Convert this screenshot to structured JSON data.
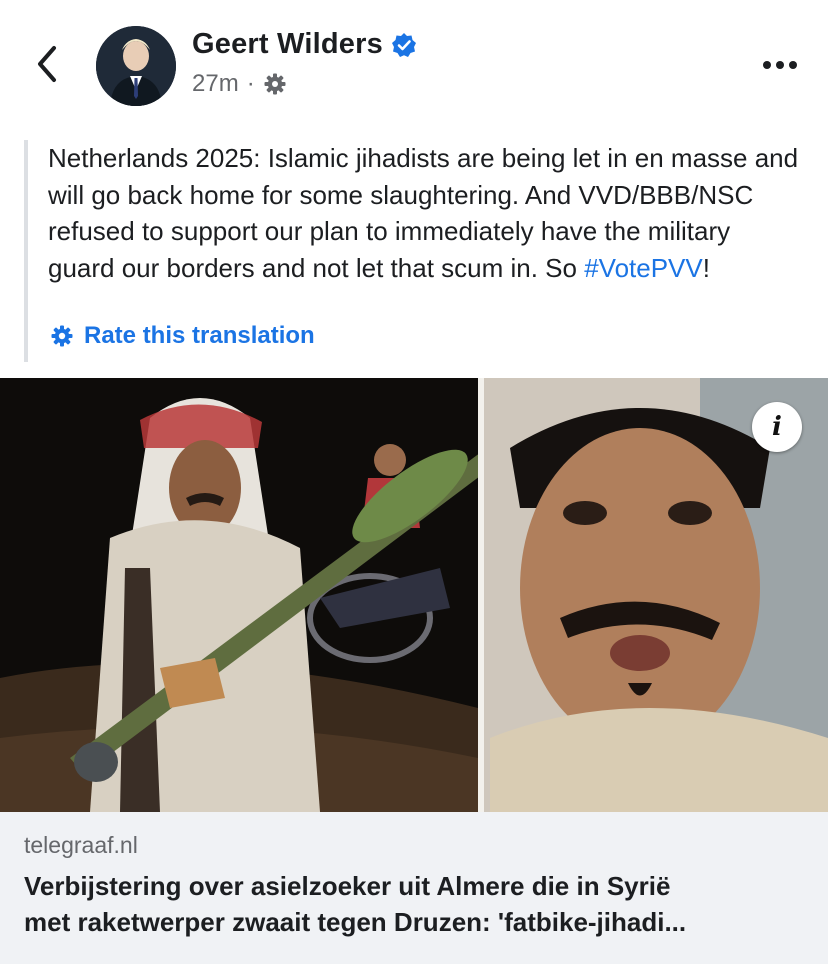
{
  "header": {
    "author_name": "Geert Wilders",
    "timestamp": "27m",
    "separator": "·",
    "privacy_icon": "gear-icon",
    "verified_icon": "verified-badge-icon",
    "verified_color": "#1b74e4"
  },
  "post": {
    "text_before": "Netherlands 2025: Islamic jihadists are being let in en masse and will go back home for some slaughtering. And VVD/BBB/NSC refused to support our plan to immediately have the military guard our borders and not let that scum in. So ",
    "hashtag": "#VotePVV",
    "text_after": "!",
    "rate_translation": "Rate this translation",
    "accent_color": "#1b74e4"
  },
  "media": {
    "info_label": "i"
  },
  "link_preview": {
    "domain": "telegraaf.nl",
    "title_line1": "Verbijstering over asielzoeker uit Almere die in Syrië",
    "title_line2": "met raketwerper zwaait tegen Druzen: 'fatbike-jihadi..."
  }
}
